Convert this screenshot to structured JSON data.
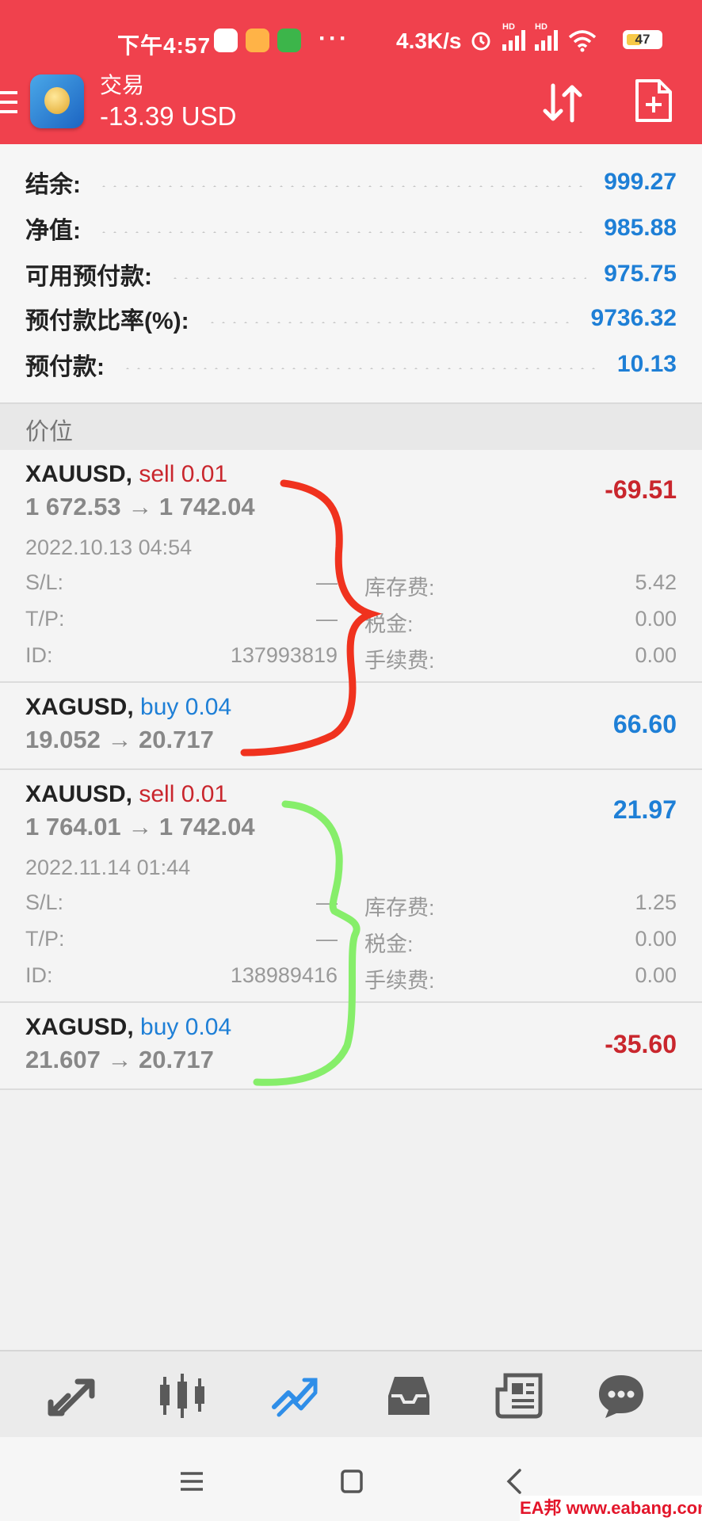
{
  "status_bar": {
    "time": "下午4:57",
    "dots": "···",
    "net_speed": "4.3K/s",
    "battery": "47",
    "signal_label": "HD"
  },
  "header": {
    "title": "交易",
    "balance": "-13.39 USD",
    "color": "#f0414d"
  },
  "account": {
    "rows": [
      {
        "label": "结余:",
        "value": "999.27"
      },
      {
        "label": "净值:",
        "value": "985.88"
      },
      {
        "label": "可用预付款:",
        "value": "975.75"
      },
      {
        "label": "预付款比率(%):",
        "value": "9736.32"
      },
      {
        "label": "预付款:",
        "value": "10.13"
      }
    ]
  },
  "section_title": "价位",
  "positions": [
    {
      "symbol": "XAUUSD,",
      "side": "sell 0.01",
      "prices": "1 672.53 → 1 742.04",
      "profit": "-69.51",
      "date": "2022.10.13 04:54",
      "sl_label": "S/L:",
      "sl": "—",
      "tp_label": "T/P:",
      "tp": "—",
      "id_label": "ID:",
      "id": "137993819",
      "swap_label": "库存费:",
      "swap": "5.42",
      "tax_label": "税金:",
      "tax": "0.00",
      "fee_label": "手续费:",
      "fee": "0.00"
    },
    {
      "symbol": "XAGUSD,",
      "side": "buy 0.04",
      "prices": "19.052 → 20.717",
      "profit": "66.60"
    },
    {
      "symbol": "XAUUSD,",
      "side": "sell 0.01",
      "prices": "1 764.01 → 1 742.04",
      "profit": "21.97",
      "date": "2022.11.14 01:44",
      "sl_label": "S/L:",
      "sl": "—",
      "tp_label": "T/P:",
      "tp": "—",
      "id_label": "ID:",
      "id": "138989416",
      "swap_label": "库存费:",
      "swap": "1.25",
      "tax_label": "税金:",
      "tax": "0.00",
      "fee_label": "手续费:",
      "fee": "0.00"
    },
    {
      "symbol": "XAGUSD,",
      "side": "buy 0.04",
      "prices": "21.607 → 20.717",
      "profit": "-35.60"
    }
  ],
  "toolbar": {
    "items": [
      "quotes-icon",
      "chart-icon",
      "trade-icon",
      "history-icon",
      "news-icon",
      "chat-icon"
    ],
    "active": "trade-icon",
    "active_color": "#2f8ee8"
  },
  "nav": [
    "menu-icon",
    "home-icon",
    "back-icon"
  ],
  "watermark": "EA邦 www.eabang.com",
  "annotation_colors": {
    "first_pair": "#f0321e",
    "second_pair": "#86ee6a"
  }
}
